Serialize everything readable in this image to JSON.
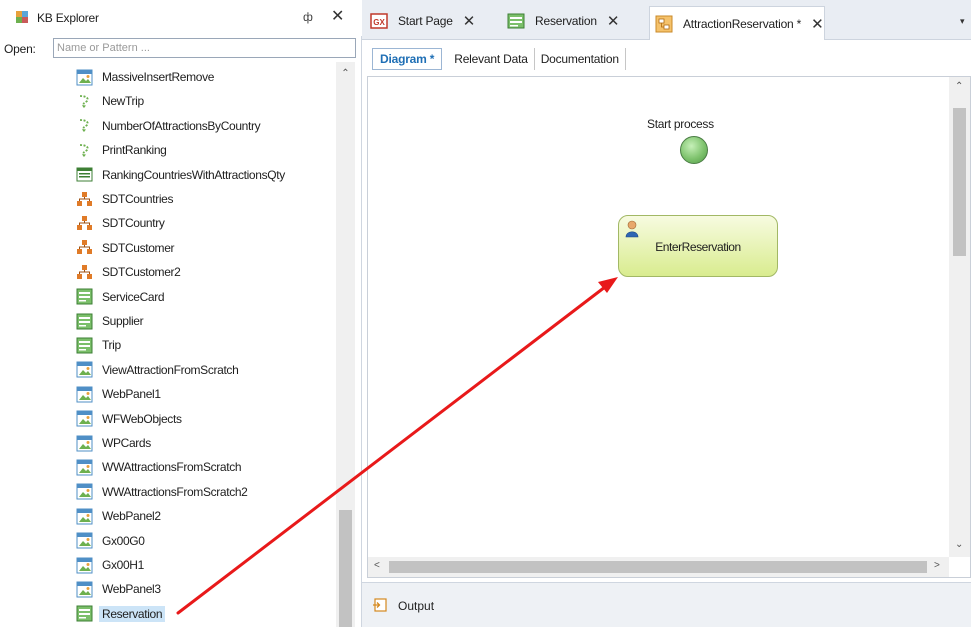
{
  "kb_explorer": {
    "title": "KB Explorer",
    "pin_glyph": "ф",
    "close_glyph": "✕",
    "open_label": "Open:",
    "open_placeholder": "Name or Pattern ...",
    "items": [
      {
        "label": "MassiveInsertRemove",
        "icon": "webpanel-icon"
      },
      {
        "label": "NewTrip",
        "icon": "procedure-icon"
      },
      {
        "label": "NumberOfAttractionsByCountry",
        "icon": "procedure-icon"
      },
      {
        "label": "PrintRanking",
        "icon": "procedure-icon"
      },
      {
        "label": "RankingCountriesWithAttractionsQty",
        "icon": "dataprovider-icon"
      },
      {
        "label": "SDTCountries",
        "icon": "sdt-icon"
      },
      {
        "label": "SDTCountry",
        "icon": "sdt-icon"
      },
      {
        "label": "SDTCustomer",
        "icon": "sdt-icon"
      },
      {
        "label": "SDTCustomer2",
        "icon": "sdt-icon"
      },
      {
        "label": "ServiceCard",
        "icon": "transaction-icon"
      },
      {
        "label": "Supplier",
        "icon": "transaction-icon"
      },
      {
        "label": "Trip",
        "icon": "transaction-icon"
      },
      {
        "label": "ViewAttractionFromScratch",
        "icon": "webpanel-icon"
      },
      {
        "label": "WebPanel1",
        "icon": "webpanel-icon"
      },
      {
        "label": "WFWebObjects",
        "icon": "webpanel-icon"
      },
      {
        "label": "WPCards",
        "icon": "webpanel-icon"
      },
      {
        "label": "WWAttractionsFromScratch",
        "icon": "webpanel-icon"
      },
      {
        "label": "WWAttractionsFromScratch2",
        "icon": "webpanel-icon"
      },
      {
        "label": "WebPanel2",
        "icon": "webpanel-icon"
      },
      {
        "label": "Gx00G0",
        "icon": "webpanel-icon"
      },
      {
        "label": "Gx00H1",
        "icon": "webpanel-icon"
      },
      {
        "label": "WebPanel3",
        "icon": "webpanel-icon"
      },
      {
        "label": "Reservation",
        "icon": "transaction-icon",
        "selected": true
      }
    ]
  },
  "tabs": [
    {
      "label": "Start Page",
      "icon": "gx-startpage-icon",
      "close": "✕"
    },
    {
      "label": "Reservation",
      "icon": "transaction-icon",
      "close": "✕"
    },
    {
      "label": "AttractionReservation *",
      "icon": "bpm-diagram-icon",
      "close": "✕",
      "active": true
    }
  ],
  "tabs_menu_glyph": "▾",
  "subtabs": [
    "Diagram *",
    "Relevant Data",
    "Documentation"
  ],
  "diagram": {
    "start_label": "Start process",
    "task_label": "EnterReservation"
  },
  "scroll_glyphs": {
    "up": "⌃",
    "down": "⌄",
    "left": "<",
    "right": ">"
  },
  "output_label": "Output",
  "colors": {
    "annotation_arrow": "#e8191a",
    "accent": "#1f6fb5",
    "selection": "#cce4f7"
  }
}
